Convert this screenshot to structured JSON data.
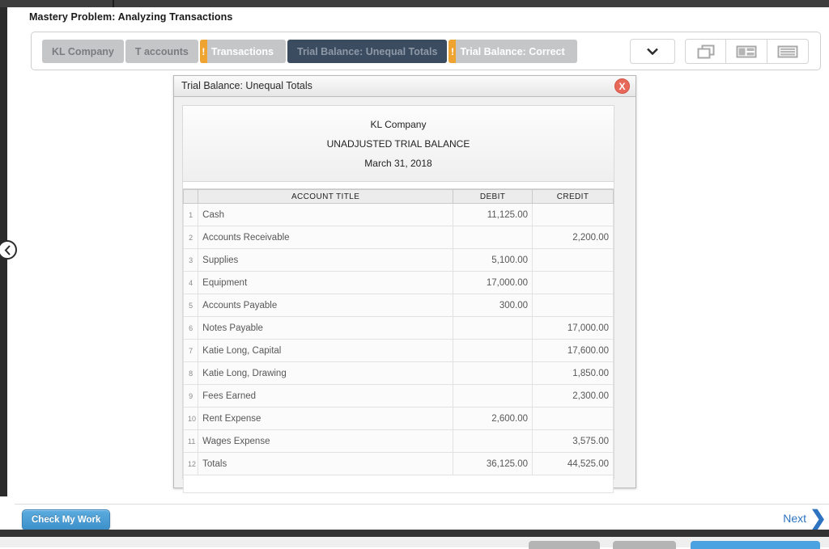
{
  "problem": {
    "title": "Mastery Problem: Analyzing Transactions"
  },
  "tabs": [
    {
      "label": "KL Company",
      "state": "normal",
      "warn": false
    },
    {
      "label": "T accounts",
      "state": "normal",
      "warn": false
    },
    {
      "label": "Transactions",
      "state": "normal",
      "warn": true
    },
    {
      "label": "Trial Balance: Unequal Totals",
      "state": "active",
      "warn": false
    },
    {
      "label": "Trial Balance: Correct",
      "state": "normal",
      "warn": true
    }
  ],
  "toolbar": {
    "dropdown_icon": "chevron-down-icon",
    "view_buttons": [
      {
        "icon": "windows-cascade-icon"
      },
      {
        "icon": "split-view-icon"
      },
      {
        "icon": "list-view-icon"
      }
    ]
  },
  "collapse_handle": {
    "icon": "chevron-left-icon"
  },
  "panel": {
    "title": "Trial Balance: Unequal Totals",
    "close_label": "X",
    "statement": {
      "company": "KL Company",
      "report": "UNADJUSTED TRIAL BALANCE",
      "date": "March 31, 2018"
    },
    "table": {
      "columns": [
        "",
        "ACCOUNT TITLE",
        "DEBIT",
        "CREDIT"
      ],
      "rows": [
        {
          "num": "1",
          "title": "Cash",
          "debit": "11,125.00",
          "credit": ""
        },
        {
          "num": "2",
          "title": "Accounts Receivable",
          "debit": "",
          "credit": "2,200.00"
        },
        {
          "num": "3",
          "title": "Supplies",
          "debit": "5,100.00",
          "credit": ""
        },
        {
          "num": "4",
          "title": "Equipment",
          "debit": "17,000.00",
          "credit": ""
        },
        {
          "num": "5",
          "title": "Accounts Payable",
          "debit": "300.00",
          "credit": ""
        },
        {
          "num": "6",
          "title": "Notes Payable",
          "debit": "",
          "credit": "17,000.00"
        },
        {
          "num": "7",
          "title": "Katie Long, Capital",
          "debit": "",
          "credit": "17,600.00"
        },
        {
          "num": "8",
          "title": "Katie Long, Drawing",
          "debit": "",
          "credit": "1,850.00"
        },
        {
          "num": "9",
          "title": "Fees Earned",
          "debit": "",
          "credit": "2,300.00"
        },
        {
          "num": "10",
          "title": "Rent Expense",
          "debit": "2,600.00",
          "credit": ""
        },
        {
          "num": "11",
          "title": "Wages Expense",
          "debit": "",
          "credit": "3,575.00"
        },
        {
          "num": "12",
          "title": "Totals",
          "debit": "36,125.00",
          "credit": "44,525.00",
          "totals": true
        }
      ]
    }
  },
  "footer": {
    "check_label": "Check My Work",
    "next_label": "Next",
    "next_icon": "chevron-right-icon"
  },
  "colors": {
    "tab_active_bg": "#3b4b60",
    "tab_bg": "#c5c6c8",
    "warn_orange": "#efa330",
    "close_red": "#e8685a",
    "accent_blue": "#3d8fc9",
    "link_blue": "#2f74c0"
  }
}
